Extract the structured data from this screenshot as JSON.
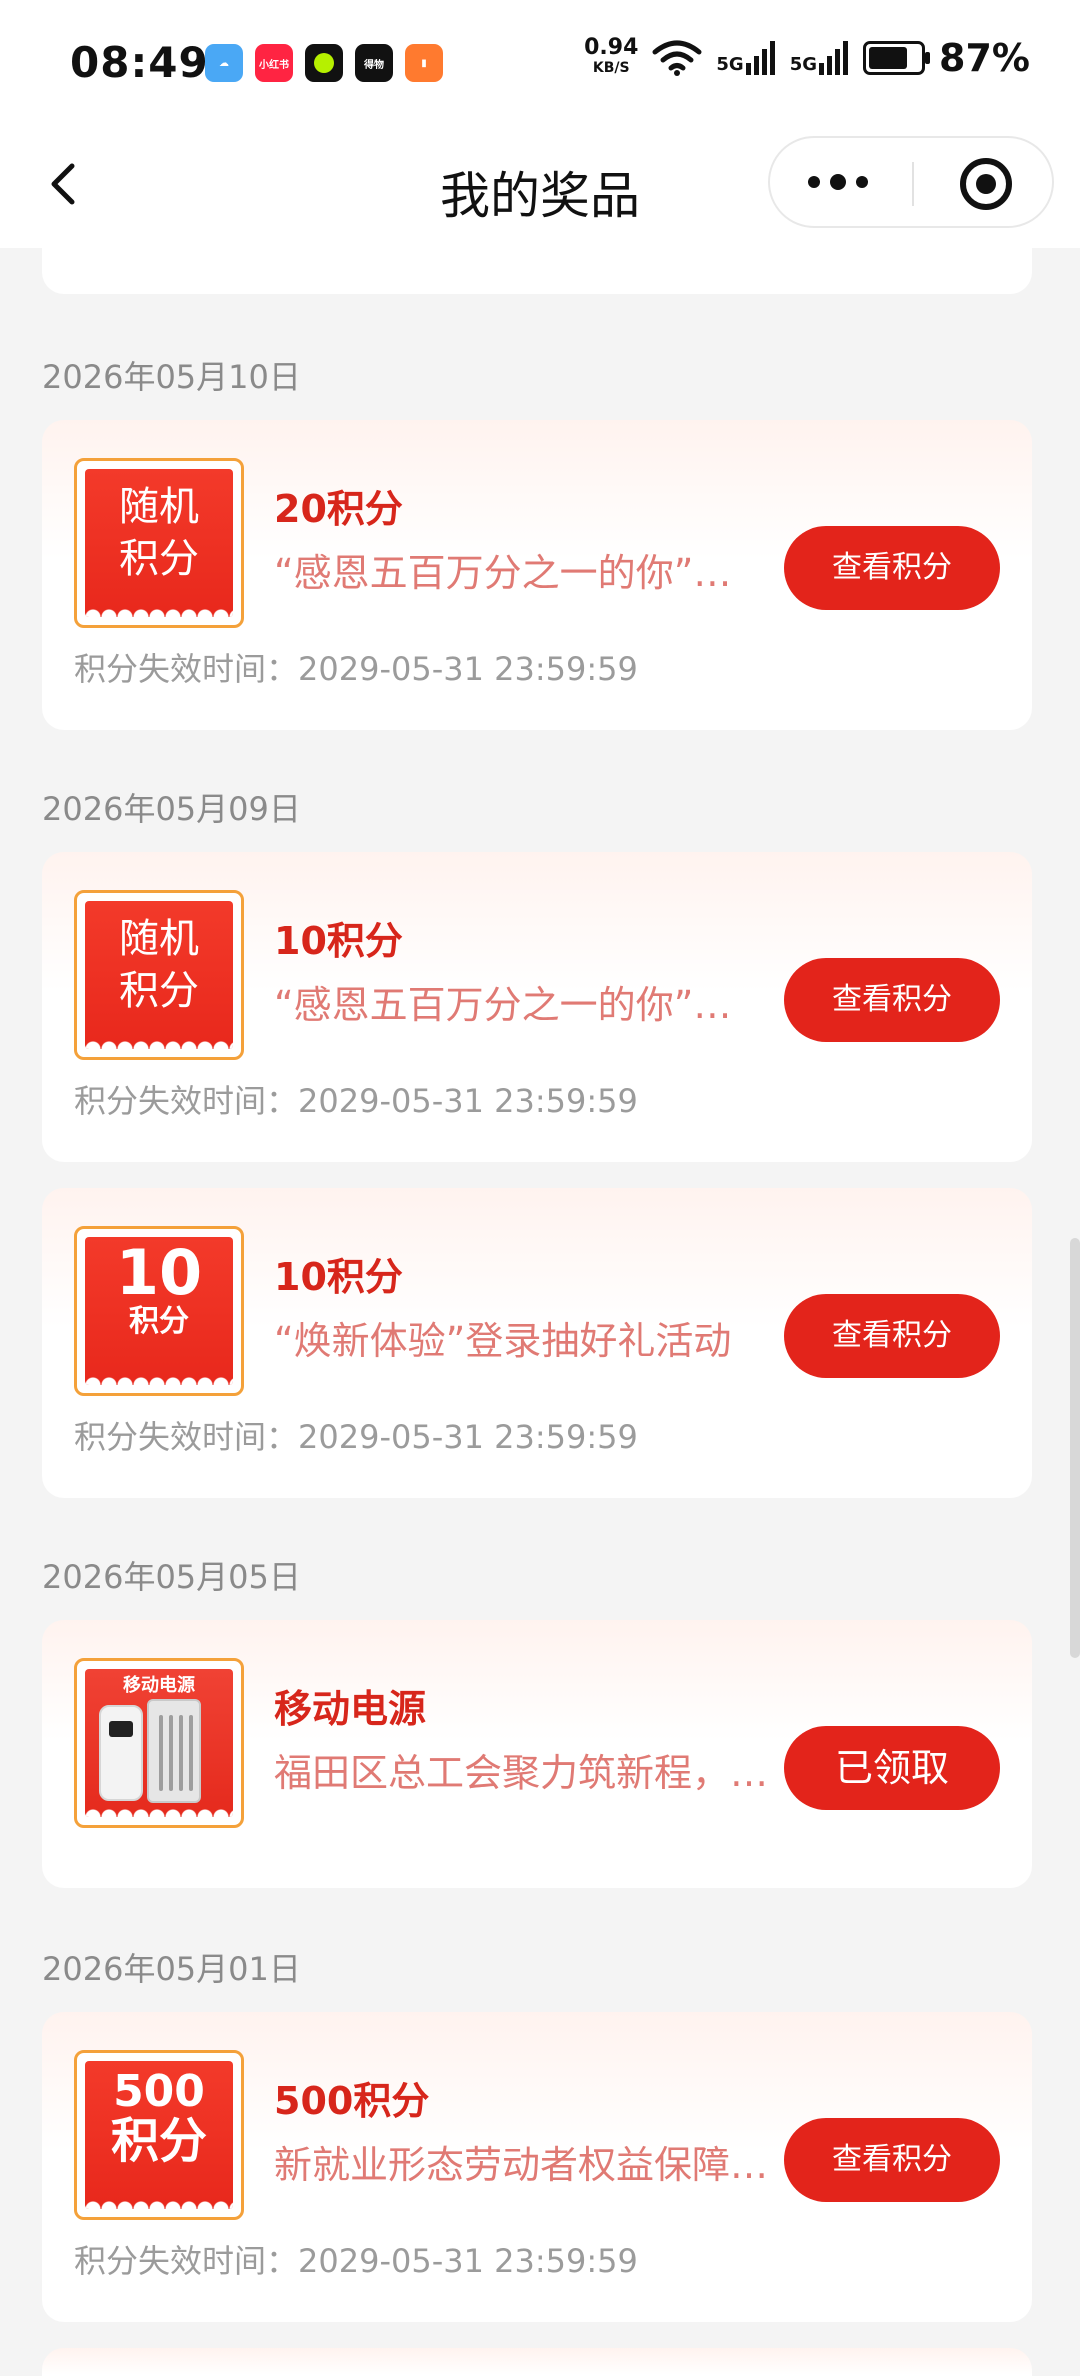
{
  "status_bar": {
    "time": "08:49",
    "apps": [
      {
        "name": "weather-app-icon",
        "color": "#4aa8f5",
        "label": ""
      },
      {
        "name": "xiaohongshu-app-icon",
        "color": "#ff2442",
        "label": "小红书"
      },
      {
        "name": "green-app-icon",
        "color": "#111111",
        "label": ""
      },
      {
        "name": "dewu-app-icon",
        "color": "#111111",
        "label": "得物"
      },
      {
        "name": "books-app-icon",
        "color": "#ff7a2f",
        "label": ""
      }
    ],
    "speed_value": "0.94",
    "speed_unit": "KB/S",
    "signal_1": "5G",
    "signal_2": "5G",
    "battery_percent": "87%",
    "battery_level": 0.87
  },
  "nav": {
    "title": "我的奖品"
  },
  "sections": [
    {
      "date": "2026年05月10日",
      "cards": [
        {
          "thumb_type": "random",
          "thumb_line1": "随机",
          "thumb_line2": "积分",
          "title": "20积分",
          "desc": "“感恩五百万分之一的你”积分抽奖活动",
          "expire": "积分失效时间：2029-05-31 23:59:59",
          "button": "查看积分"
        }
      ]
    },
    {
      "date": "2026年05月09日",
      "cards": [
        {
          "thumb_type": "random",
          "thumb_line1": "随机",
          "thumb_line2": "积分",
          "title": "10积分",
          "desc": "“感恩五百万分之一的你”积分抽奖活动",
          "expire": "积分失效时间：2029-05-31 23:59:59",
          "button": "查看积分"
        },
        {
          "thumb_type": "number",
          "thumb_line1": "10",
          "thumb_line2": "积分",
          "title": "10积分",
          "desc": "“焕新体验”登录抽好礼活动",
          "expire": "积分失效时间：2029-05-31 23:59:59",
          "button": "查看积分"
        }
      ]
    },
    {
      "date": "2026年05月05日",
      "cards": [
        {
          "thumb_type": "powerbank",
          "thumb_line1": "移动电源",
          "title": "移动电源",
          "desc": "福田区总工会聚力筑新程，奋斗新征程",
          "button": "已领取"
        }
      ]
    },
    {
      "date": "2026年05月01日",
      "cards": [
        {
          "thumb_type": "number500",
          "thumb_line1": "500",
          "thumb_line2": "积分",
          "title": "500积分",
          "desc": "新就业形态劳动者权益保障活动",
          "expire": "积分失效时间：2029-05-31 23:59:59",
          "button": "查看积分"
        }
      ]
    }
  ]
}
